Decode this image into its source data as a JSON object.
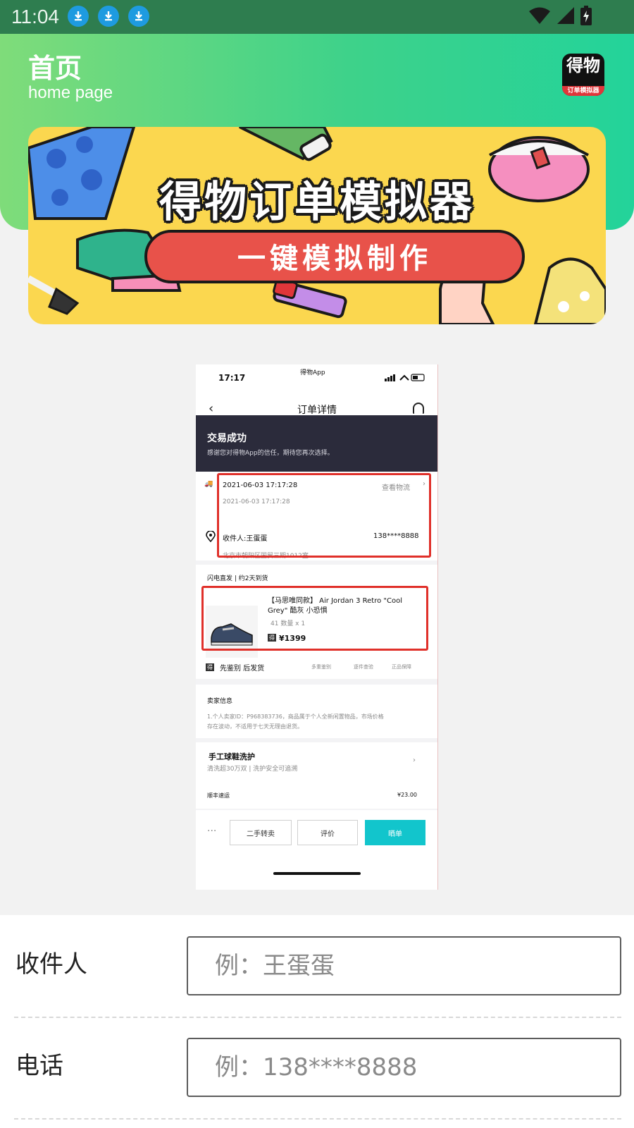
{
  "status_bar": {
    "time": "11:04",
    "notification_icons": [
      "download-icon",
      "download-icon",
      "download-icon"
    ],
    "right_icons": [
      "wifi-icon",
      "signal-icon",
      "battery-charging-icon"
    ]
  },
  "header": {
    "title": "首页",
    "subtitle": "home page",
    "logo_text": "得物",
    "logo_caption": "订单模拟器"
  },
  "banner": {
    "title": "得物订单模拟器",
    "subtitle": "一键模拟制作"
  },
  "preview": {
    "phone_time": "17:17",
    "phone_app": "得物App",
    "nav_title": "订单详情",
    "status_title": "交易成功",
    "status_subtitle": "感谢您对得物App的信任，期待您再次选择。",
    "logistics_time": "2021-06-03  17:17:28",
    "logistics_link": "查看物流",
    "logistics_sub_time": "2021-06-03  17:17:28",
    "recipient_label": "收件人:王蛋蛋",
    "recipient_phone": "138****8888",
    "address": "北京市朝阳区国贸三期1012室",
    "shipping_tag": "闪电直发 | 约2天到货",
    "product_name_line1": "【马思唯同款】 Air Jordan 3 Retro \"Cool",
    "product_name_line2": "Grey\" 酷灰 小恐惧",
    "product_spec": "41  数量 x 1",
    "product_price": "¥1399",
    "inspect_title": "先鉴别 后发货",
    "inspect_tags": [
      "多重鉴别",
      "逐件查验",
      "正品保障"
    ],
    "seller_title": "卖家信息",
    "seller_desc_line1": "1.个人卖家ID：P968383736，商品属于个人全新闲置物品，市场价格",
    "seller_desc_line2": "存在波动，不适用于七天无理由退货。",
    "wash_title": "手工球鞋洗护",
    "wash_sub": "清洗超30万双 | 洗护安全可追溯",
    "shipping_method": "顺丰速运",
    "shipping_fee": "¥23.00",
    "more_label": "···",
    "btn_resell": "二手转卖",
    "btn_review": "评价",
    "btn_share": "晒单"
  },
  "form": {
    "recipient_label": "收件人",
    "recipient_placeholder": "例：王蛋蛋",
    "phone_label": "电话",
    "phone_placeholder": "例：138****8888"
  },
  "colors": {
    "status_bar": "#2e7d4f",
    "header_start": "#7fdc7a",
    "header_end": "#23d39a",
    "banner_bg": "#fbd74f",
    "accent_red": "#e0302a",
    "teal_button": "#12c5cc"
  }
}
